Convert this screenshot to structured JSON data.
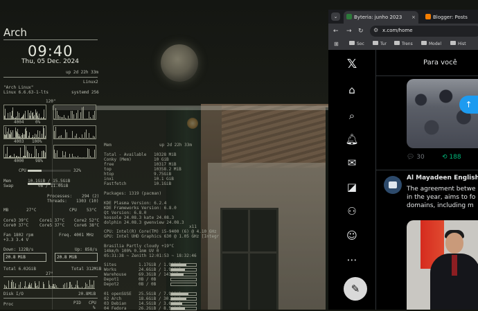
{
  "conky": {
    "hostname": "Arch",
    "time": "09:40",
    "date": "Thu, 05 Dec. 2024",
    "uptime": "up  2d 22h 33m",
    "linux2": "Linux2",
    "os_name": "\"Arch Linux\"",
    "kernel": "Linux 6.6.63-1-lts",
    "systemd": "systemd 256",
    "cpu_graph_max": "120\"",
    "g_row1_left": "4004",
    "g_row1_right": "0%",
    "g_row2_left": "4003",
    "g_row2_right": "100%",
    "g_row3_left": "4000",
    "g_row3_right": "98%",
    "cpu_label": "CPU",
    "cpu_pct": "32%",
    "cpu_pct_value": 32,
    "mem_label": "Mem",
    "mem_value": "10.1GiB / 15.5GiB",
    "mem_fraction": 0.65,
    "swap_label": "Swap",
    "swap_value": "0B / 11.0GiB",
    "swap_fraction": 0.0,
    "processes": "Processes:",
    "processes_val": "294 (2)",
    "threads": "Threads:",
    "threads_val": "1303 (10)",
    "mb_label": "MB",
    "mb_temp": "27°C",
    "cpu2_label": "CPU",
    "cpu2_temp": "53°C",
    "core0": "Core0  37°C",
    "core1": "Core1  37°C",
    "core2": "Core2  52°C",
    "core3": "Core3  39°C",
    "core5": "Core5  37°C",
    "core6": "Core6  38°C",
    "fan": "Fan    1802 rpm",
    "volt": "+3.3      3.4 V",
    "freq": "Freq.   4001  MHz",
    "down": "Down: 122B/s",
    "up": "Up: 858/s",
    "down_box": "20.8 MiB",
    "up_box": "20.8 MiB",
    "total_down": "Total 6.02GiB",
    "total_up": "Total 312MiB",
    "temp_bottom": "27°",
    "disk_io": "Disk I/O",
    "disk_io_val": "20.8MiB",
    "proc": "Proc",
    "pid": "PID",
    "cpu_col": "CPU",
    "pct_col": "%"
  },
  "mid": {
    "mem_h": "Mem",
    "uptime2": "up  2d 22h 33m",
    "rows": [
      [
        "Total - Available",
        "10328 MiB"
      ],
      [
        "Conky (Mem)",
        "10 GiB"
      ],
      [
        "free",
        "10317   MiB"
      ],
      [
        "top",
        "10358.2  MiB"
      ],
      [
        "htop",
        "9.75GiB"
      ],
      [
        "inxi",
        "10.1 GiB"
      ],
      [
        "Fastfetch",
        "10.1GiB"
      ]
    ],
    "packages": "Packages: 1319 (pacman)",
    "kde": [
      "KDE Plasma Version: 6.2.4",
      "KDE Frameworks Version: 6.8.0",
      "Qt Version: 6.8.0",
      "kossole 24.08.3       kate 24.08.3",
      "dolphin 24.08.3      gwenview 24.08.3"
    ],
    "x11": "x11",
    "cpu_line": "CPU: Intel(R) Core(TM) i5-9400 (6) @ 4.10 GHz",
    "gpu_line": "GPU: Intel UHD Graphics 630 @ 1.05 GHz [Integr",
    "weather": [
      "Brasília   Partly cloudy  +19°C",
      "14km/h   100%   0.1mm   UV 0",
      "05:31:38 ~ Zenith 12:01:53 ~ 18:32:46"
    ],
    "disks": [
      {
        "name": "Sites",
        "val": "1.17GiB  /  1.90GiB",
        "frac": 0.62
      },
      {
        "name": "Works",
        "val": "24.6GiB  /  1.90GiB",
        "frac": 0.55
      },
      {
        "name": "Warehouse",
        "val": "69.3GiB  /  141GiB",
        "frac": 0.49
      },
      {
        "name": "Depot1",
        "val": "0B  /  0B",
        "frac": 0.0
      },
      {
        "name": "Depot2",
        "val": "0B  /  0B",
        "frac": 0.0
      }
    ],
    "parts": [
      {
        "name": "01 openSUSE",
        "val": "25.5GiB  /  7.99GiB",
        "frac": 0.7
      },
      {
        "name": "02 Arch",
        "val": "18.6GiB  /  30.1GiB",
        "frac": 0.6
      },
      {
        "name": "03 Debian",
        "val": "14.5GiB  /  3.64GiB",
        "frac": 0.45
      },
      {
        "name": "04 Fedora",
        "val": "26.2GiB  /  8.54GiB",
        "frac": 0.55
      }
    ]
  },
  "browser": {
    "tabs_button": "⌄",
    "tab1": "Byteria: junho 2023",
    "tab2": "Blogger: Posts",
    "tab_close": "×",
    "url": "x.com/home",
    "bookmarks": [
      "Soc",
      "Tur",
      "Trens",
      "Model",
      "Hist"
    ],
    "apps_icon": "apps-grid-icon",
    "fav1_color": "#2d7a3a",
    "fav2_color": "#f57d00"
  },
  "x": {
    "logo": "𝕏",
    "feed_tab": "Para você",
    "replies": "30",
    "retweets": "188",
    "post_name": "Al Mayadeen English",
    "post_lines": [
      "The agreement betwe",
      "in the year, aims to fo",
      "domains, including m"
    ],
    "accent": "#1d9bf0"
  }
}
